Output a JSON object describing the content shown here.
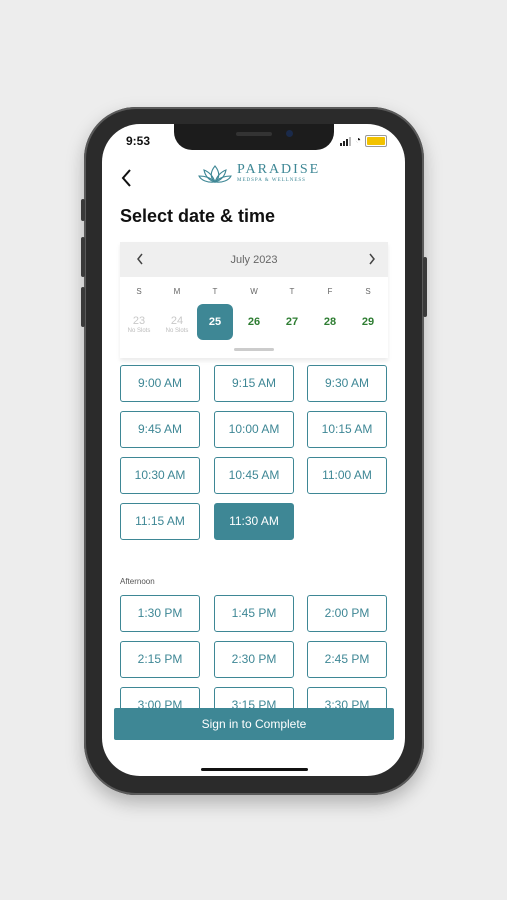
{
  "status": {
    "time": "9:53"
  },
  "header": {
    "brand_name": "PARADISE",
    "brand_tagline": "MEDSPA & WELLNESS"
  },
  "page": {
    "title": "Select date & time"
  },
  "calendar": {
    "month_label": "July 2023",
    "weekdays": [
      "S",
      "M",
      "T",
      "W",
      "T",
      "F",
      "S"
    ],
    "days": [
      {
        "num": "23",
        "sub": "No Slots",
        "state": "disabled"
      },
      {
        "num": "24",
        "sub": "No Slots",
        "state": "disabled"
      },
      {
        "num": "25",
        "sub": "",
        "state": "selected"
      },
      {
        "num": "26",
        "sub": "",
        "state": "available"
      },
      {
        "num": "27",
        "sub": "",
        "state": "available"
      },
      {
        "num": "28",
        "sub": "",
        "state": "available"
      },
      {
        "num": "29",
        "sub": "",
        "state": "available"
      }
    ]
  },
  "morning_slots": [
    "9:00 AM",
    "9:15 AM",
    "9:30 AM",
    "9:45 AM",
    "10:00 AM",
    "10:15 AM",
    "10:30 AM",
    "10:45 AM",
    "11:00 AM",
    "11:15 AM",
    "11:30 AM"
  ],
  "selected_slot": "11:30 AM",
  "afternoon": {
    "label": "Afternoon",
    "slots": [
      "1:30 PM",
      "1:45 PM",
      "2:00 PM",
      "2:15 PM",
      "2:30 PM",
      "2:45 PM",
      "3:00 PM",
      "3:15 PM",
      "3:30 PM"
    ]
  },
  "cta": {
    "label": "Sign in to Complete"
  },
  "colors": {
    "accent": "#3e8795",
    "available": "#2e7d32",
    "battery": "#f2c200"
  },
  "icons": {
    "back": "chevron-left-icon",
    "prev": "chevron-left-icon",
    "next": "chevron-right-icon",
    "logo": "lotus-icon"
  }
}
